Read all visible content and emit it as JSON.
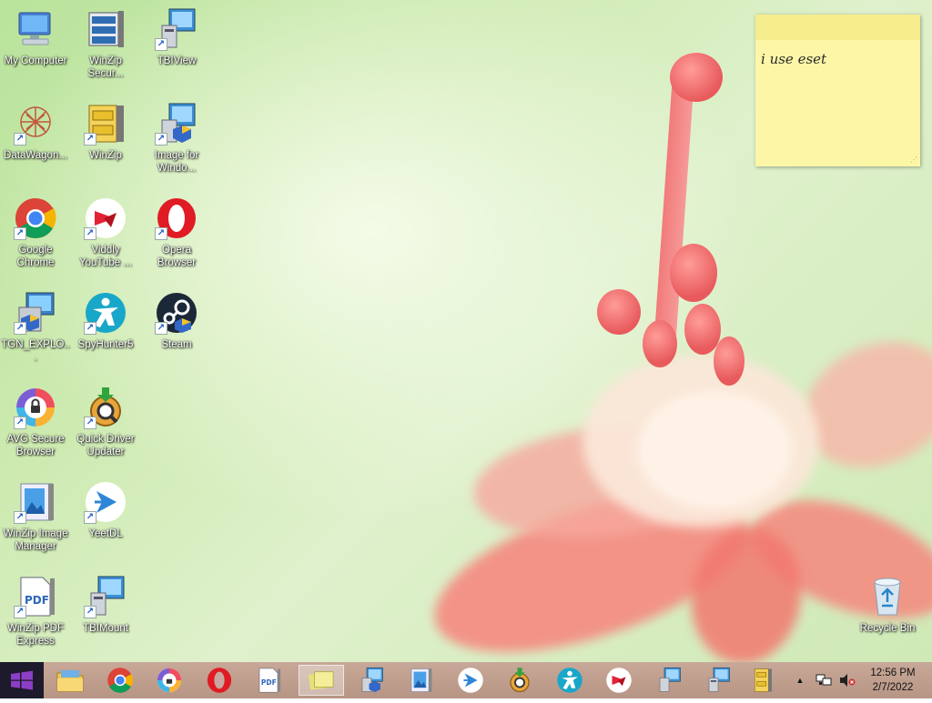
{
  "desktop_icons": [
    {
      "label": "My Computer",
      "icon": "computer-icon"
    },
    {
      "label": "WinZip Secur...",
      "icon": "winzip-secure-icon"
    },
    {
      "label": "TBIView",
      "icon": "tbiview-icon"
    },
    {
      "label": "DataWagon...",
      "icon": "datawagon-icon"
    },
    {
      "label": "WinZip",
      "icon": "winzip-icon"
    },
    {
      "label": "Image for Windo...",
      "icon": "image-for-windows-icon"
    },
    {
      "label": "Google Chrome",
      "icon": "chrome-icon"
    },
    {
      "label": "Viddly YouTube ...",
      "icon": "viddly-icon"
    },
    {
      "label": "Opera Browser",
      "icon": "opera-icon"
    },
    {
      "label": "TGN_EXPLO...",
      "icon": "installer-icon"
    },
    {
      "label": "SpyHunter5",
      "icon": "spyhunter-icon"
    },
    {
      "label": "Steam",
      "icon": "steam-icon"
    },
    {
      "label": "AVG Secure Browser",
      "icon": "avg-browser-icon"
    },
    {
      "label": "Quick Driver Updater",
      "icon": "quick-driver-updater-icon"
    },
    {
      "label": "WinZip Image Manager",
      "icon": "winzip-image-manager-icon"
    },
    {
      "label": "YeetDL",
      "icon": "yeetdl-icon"
    },
    {
      "label": "WinZip PDF Express",
      "icon": "winzip-pdf-icon"
    },
    {
      "label": "TBIMount",
      "icon": "tbimount-icon"
    },
    {
      "label": "Recycle Bin",
      "icon": "recycle-bin-icon"
    }
  ],
  "sticky_note": {
    "text": "i use eset"
  },
  "taskbar": {
    "start_icon": "windows-logo-icon",
    "pinned": [
      {
        "name": "file-explorer",
        "icon": "folder-icon"
      },
      {
        "name": "chrome",
        "icon": "chrome-icon"
      },
      {
        "name": "avg-browser",
        "icon": "avg-browser-icon"
      },
      {
        "name": "opera",
        "icon": "opera-icon"
      },
      {
        "name": "winzip-pdf",
        "icon": "winzip-pdf-icon"
      },
      {
        "name": "sticky-notes",
        "icon": "sticky-notes-icon"
      },
      {
        "name": "image-for-windows",
        "icon": "image-for-windows-icon"
      },
      {
        "name": "winzip-image-manager",
        "icon": "winzip-image-manager-icon"
      },
      {
        "name": "yeetdl",
        "icon": "yeetdl-icon"
      },
      {
        "name": "quick-driver-updater",
        "icon": "quick-driver-updater-icon"
      },
      {
        "name": "spyhunter",
        "icon": "spyhunter-icon"
      },
      {
        "name": "viddly",
        "icon": "viddly-icon"
      },
      {
        "name": "tbiview",
        "icon": "tbiview-icon"
      },
      {
        "name": "tbimount",
        "icon": "tbimount-icon"
      },
      {
        "name": "winzip",
        "icon": "winzip-icon"
      }
    ],
    "tray": {
      "time": "12:56 PM",
      "date": "2/7/2022"
    }
  },
  "colors": {
    "taskbar": "#b99888",
    "start_button": "#1d1a2b",
    "sticky_note": "#fdf6a6",
    "windows_logo": "#8b3ec6"
  }
}
